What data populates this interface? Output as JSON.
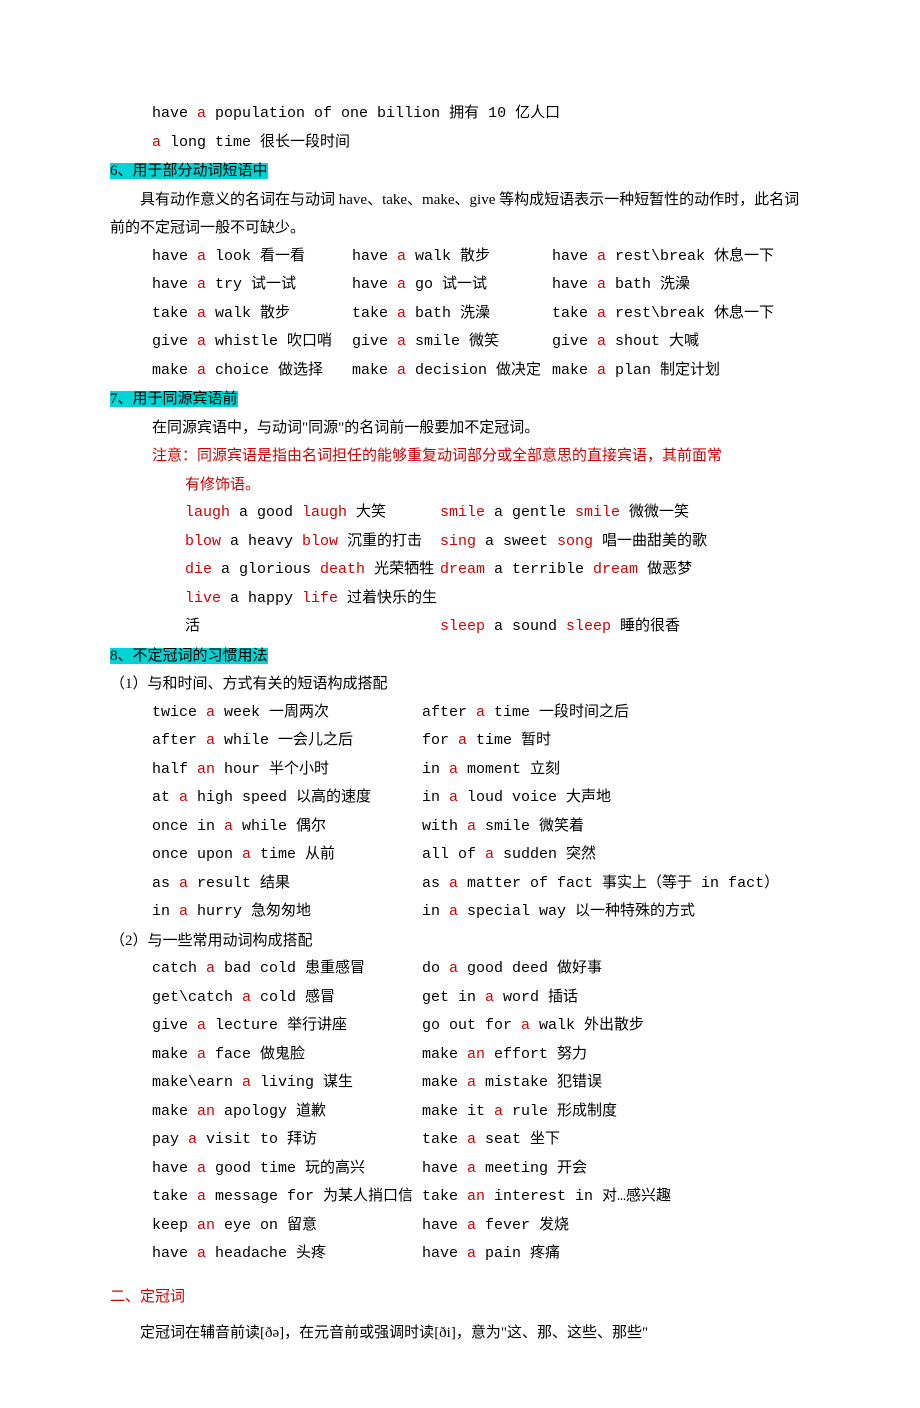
{
  "intro": {
    "l1_pre": "have ",
    "l1_a": "a",
    "l1_post": " population of one billion  拥有 10 亿人口",
    "l2_a": "a",
    "l2_post": " long time  很长一段时间"
  },
  "s6": {
    "title": "6、用于部分动词短语中",
    "desc": "具有动作意义的名词在与动词 have、take、make、give 等构成短语表示一种短暂性的动作时，此名词前的不定冠词一般不可缺少。",
    "r": [
      [
        "have ",
        " look  看一看",
        "have ",
        " walk  散步",
        "have ",
        " rest\\break  休息一下"
      ],
      [
        "have ",
        " try  试一试",
        "have ",
        " go  试一试",
        "have ",
        " bath  洗澡"
      ],
      [
        "take ",
        " walk  散步",
        "take ",
        " bath  洗澡",
        "take ",
        " rest\\break  休息一下"
      ],
      [
        "give ",
        " whistle  吹口哨",
        "give ",
        " smile 微笑",
        "give ",
        " shout   大喊"
      ],
      [
        "make ",
        " choice 做选择",
        "make ",
        " decision 做决定",
        "make ",
        " plan   制定计划"
      ]
    ],
    "a": "a"
  },
  "s7": {
    "title": "7、用于同源宾语前",
    "desc": "在同源宾语中，与动词\"同源\"的名词前一般要加不定冠词。",
    "note1": "注意：同源宾语是指由名词担任的能够重复动词部分或全部意思的直接宾语，其前面常",
    "note2": "有修饰语。",
    "ex": [
      {
        "l": [
          "laugh",
          " a good ",
          "laugh",
          " 大笑"
        ],
        "r": [
          "smile",
          " a gentle ",
          "smile",
          " 微微一笑"
        ]
      },
      {
        "l": [
          "blow",
          " a heavy ",
          "blow",
          " 沉重的打击"
        ],
        "r": [
          "sing",
          " a sweet ",
          "song",
          " 唱一曲甜美的歌"
        ]
      },
      {
        "l": [
          "die",
          " a glorious ",
          "death",
          " 光荣牺牲"
        ],
        "r": [
          "dream",
          " a terrible ",
          "dream",
          " 做恶梦"
        ]
      },
      {
        "l": [
          "live",
          " a happy ",
          "life",
          " 过着快乐的生活"
        ],
        "r": [
          "sleep",
          " a sound ",
          "sleep",
          " 睡的很香"
        ]
      }
    ]
  },
  "s8": {
    "title": "8、不定冠词的习惯用法",
    "sub1": "（1）与和时间、方式有关的短语构成搭配",
    "p1": [
      {
        "l": [
          "twice ",
          " week 一周两次"
        ],
        "r": [
          "after ",
          " time 一段时间之后"
        ]
      },
      {
        "l": [
          "after ",
          " while 一会儿之后"
        ],
        "r": [
          "for ",
          " time 暂时"
        ]
      },
      {
        "l": [
          "half ",
          " hour 半个小时",
          "an"
        ],
        "r": [
          "in ",
          " moment 立刻"
        ]
      },
      {
        "l": [
          "at ",
          " high speed 以高的速度"
        ],
        "r": [
          "in ",
          " loud voice 大声地"
        ]
      },
      {
        "l": [
          "once in ",
          " while 偶尔"
        ],
        "r": [
          "with ",
          " smile 微笑着"
        ]
      },
      {
        "l": [
          "once upon ",
          " time 从前"
        ],
        "r": [
          "all of ",
          " sudden 突然"
        ]
      },
      {
        "l": [
          "as ",
          " result 结果"
        ],
        "r": [
          "as ",
          " matter of fact 事实上（等于 in fact）"
        ]
      },
      {
        "l": [
          "in ",
          " hurry 急匆匆地"
        ],
        "r": [
          "in ",
          " special way 以一种特殊的方式"
        ]
      }
    ],
    "a": "a",
    "sub2": "（2）与一些常用动词构成搭配",
    "p2": [
      {
        "l": [
          "catch ",
          " bad cold 患重感冒"
        ],
        "r": [
          "do ",
          " good deed 做好事"
        ]
      },
      {
        "l": [
          "get\\catch ",
          " cold 感冒"
        ],
        "r": [
          "get in ",
          " word 插话"
        ]
      },
      {
        "l": [
          "give ",
          " lecture 举行讲座"
        ],
        "r": [
          "go out for ",
          " walk 外出散步"
        ]
      },
      {
        "l": [
          "make ",
          " face 做鬼脸"
        ],
        "r": [
          "make ",
          " effort 努力",
          "an"
        ]
      },
      {
        "l": [
          "make\\earn ",
          " living 谋生"
        ],
        "r": [
          "make ",
          " mistake 犯错误"
        ]
      },
      {
        "l": [
          "make ",
          " apology 道歉",
          "an"
        ],
        "r": [
          "make it ",
          " rule 形成制度"
        ]
      },
      {
        "l": [
          "pay ",
          " visit to 拜访"
        ],
        "r": [
          "take ",
          " seat 坐下"
        ]
      },
      {
        "l": [
          "have ",
          " good time 玩的高兴"
        ],
        "r": [
          "have ",
          " meeting 开会"
        ]
      },
      {
        "l": [
          "take ",
          " message for 为某人捎口信"
        ],
        "r": [
          "take ",
          " interest in 对…感兴趣",
          "an"
        ]
      },
      {
        "l": [
          "keep ",
          " eye on 留意",
          "an"
        ],
        "r": [
          "have ",
          " fever 发烧"
        ]
      },
      {
        "l": [
          "have ",
          " headache 头疼"
        ],
        "r": [
          "have ",
          " pain 疼痛"
        ]
      }
    ]
  },
  "s_def": {
    "title": "二、定冠词",
    "body_pre": "定冠词在辅音前读",
    "ph1": "[ðə]",
    "body_mid": "，在元音前或强调时读",
    "ph2": "[ði]",
    "body_post": "，意为\"这、那、这些、那些\""
  }
}
